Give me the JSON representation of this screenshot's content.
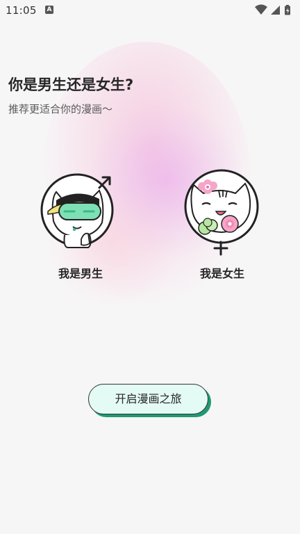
{
  "status_bar": {
    "time": "11:05",
    "notification_icon": "a-icon",
    "icons": [
      "wifi-icon",
      "signal-icon",
      "battery-icon"
    ]
  },
  "header": {
    "title": "你是男生还是女生?",
    "subtitle": "推荐更适合你的漫画～"
  },
  "choices": {
    "male": {
      "label": "我是男生",
      "icon": "male-symbol-icon"
    },
    "female": {
      "label": "我是女生",
      "icon": "female-symbol-icon"
    }
  },
  "start_button": {
    "label": "开启漫画之旅"
  },
  "colors": {
    "background": "#f7f6f7",
    "button_fill": "#e4faf4",
    "button_shadow": "#1f9a72",
    "mint_accent": "#7ee0b5",
    "pink_accent": "#f6a5c8"
  }
}
